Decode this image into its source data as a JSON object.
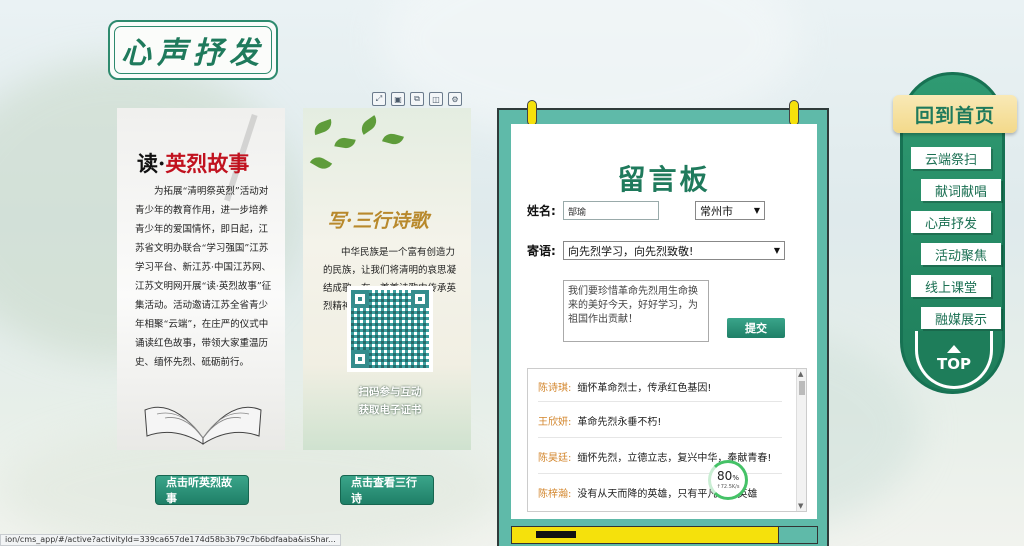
{
  "section_title": "心声抒发",
  "card1": {
    "title_prefix": "读·",
    "title_red": "英烈故事",
    "body": "为拓展“清明祭英烈”活动对青少年的教育作用，进一步培养青少年的爱国情怀，即日起，江苏省文明办联合“学习强国”江苏学习平台、新江苏·中国江苏网、江苏文明网开展“读·英烈故事”征集活动。活动邀请江苏全省青少年相聚“云端”，在庄严的仪式中诵读红色故事，带领大家重温历史、缅怀先烈、砥砺前行。",
    "button": "点击听英烈故事"
  },
  "card2": {
    "title": "写·三行诗歌",
    "body": "中华民族是一个富有创造力的民族，让我们将清明的哀思凝结成歌，在一首首诗歌中传承英烈精神。",
    "qr_caption_1": "扫码参与互动",
    "qr_caption_2": "获取电子证书",
    "button": "点击查看三行诗"
  },
  "board": {
    "title": "留言板",
    "name_label": "姓名:",
    "name_value": "郜瑜",
    "city_value": "常州市",
    "message_label": "寄语:",
    "message_value": "向先烈学习，向先烈致敬!",
    "textarea_value": "我们要珍惜革命先烈用生命换来的美好今天，好好学习，为祖国作出贡献！",
    "submit": "提交",
    "messages": [
      {
        "name": "陈诗琪:",
        "text": "缅怀革命烈士，传承红色基因!"
      },
      {
        "name": "王欣妍:",
        "text": "革命先烈永垂不朽!"
      },
      {
        "name": "陈昊廷:",
        "text": "缅怀先烈，立德立志，复兴中华，奉献青春!"
      },
      {
        "name": "陈梓瀚:",
        "text": "没有从天而降的英雄，只有平凡人的英雄"
      }
    ]
  },
  "speed_widget": {
    "percent": "80",
    "percent_unit": "%",
    "rate": "↑72.5K/s"
  },
  "nav": {
    "home": "回到首页",
    "items": [
      "云端祭扫",
      "献词献唱",
      "心声抒发",
      "活动聚焦",
      "线上课堂",
      "融媒展示"
    ],
    "top": "TOP"
  },
  "toolbar_icons": [
    "share-icon",
    "save-icon",
    "copy-icon",
    "layers-icon",
    "settings-icon"
  ],
  "status_url": "ion/cms_app/#/active?activityId=339ca657de174d58b3b79c7b6bdfaaba&isShar..."
}
